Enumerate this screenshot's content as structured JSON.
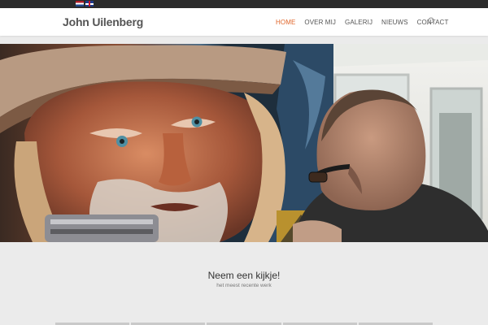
{
  "topbar": {
    "languages": [
      {
        "code": "nl",
        "icon": "dutch-flag-icon"
      },
      {
        "code": "en",
        "icon": "english-flag-icon"
      }
    ]
  },
  "header": {
    "logo": "John Uilenberg",
    "nav": [
      {
        "label": "HOME",
        "active": true
      },
      {
        "label": "OVER MIJ",
        "active": false
      },
      {
        "label": "GALERIJ",
        "active": false
      },
      {
        "label": "NIEUWS",
        "active": false
      },
      {
        "label": "CONTACT",
        "active": false
      }
    ],
    "search_icon": "search-icon",
    "accent_color": "#e0662a"
  },
  "hero": {
    "image": "painter-at-mural-photo"
  },
  "section": {
    "title": "Neem een kijkje!",
    "subtitle": "het meest recente werk"
  }
}
